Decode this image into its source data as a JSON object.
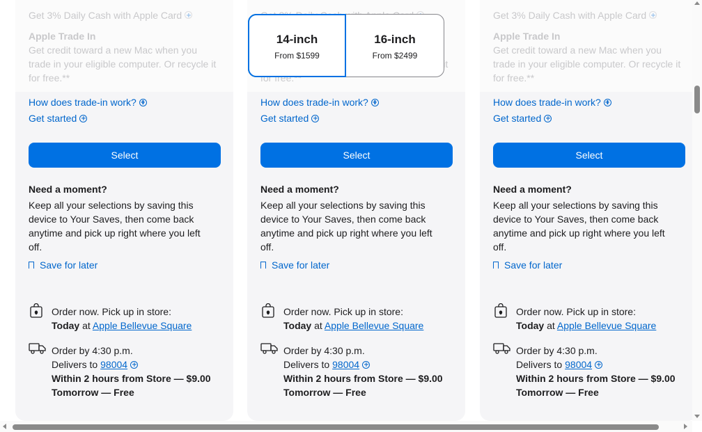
{
  "size_toggle": {
    "options": [
      {
        "size": "14-inch",
        "price": "From $1599",
        "selected": true
      },
      {
        "size": "16-inch",
        "price": "From $2499",
        "selected": false
      }
    ]
  },
  "faded": {
    "cash": "Get 3% Daily Cash with Apple Card",
    "trade_title": "Apple Trade In",
    "trade_body": "Get credit toward a new Mac when you trade in your eligible computer. Or recycle it for free.**"
  },
  "cards": [
    {
      "trade_link": "How does trade-in work?",
      "get_started": "Get started",
      "select_label": "Select",
      "moment_title": "Need a moment?",
      "moment_body": "Keep all your selections by saving this device to Your Saves, then come back anytime and pick up right where you left off.",
      "save_label": "Save for later",
      "pickup_label": "Order now. Pick up in store:",
      "pickup_day": "Today",
      "pickup_at": "at",
      "store": "Apple Bellevue Square",
      "order_by": "Order by 4:30 p.m.",
      "delivers_to": "Delivers to",
      "zip": "98004",
      "delivery_fast": "Within 2 hours from Store — $9.00",
      "delivery_free": "Tomorrow — Free"
    },
    {
      "trade_link": "How does trade-in work?",
      "get_started": "Get started",
      "select_label": "Select",
      "moment_title": "Need a moment?",
      "moment_body": "Keep all your selections by saving this device to Your Saves, then come back anytime and pick up right where you left off.",
      "save_label": "Save for later",
      "pickup_label": "Order now. Pick up in store:",
      "pickup_day": "Today",
      "pickup_at": "at",
      "store": "Apple Bellevue Square",
      "order_by": "Order by 4:30 p.m.",
      "delivers_to": "Delivers to",
      "zip": "98004",
      "delivery_fast": "Within 2 hours from Store — $9.00",
      "delivery_free": "Tomorrow — Free"
    },
    {
      "trade_link": "How does trade-in work?",
      "get_started": "Get started",
      "select_label": "Select",
      "moment_title": "Need a moment?",
      "moment_body": "Keep all your selections by saving this device to Your Saves, then come back anytime and pick up right where you left off.",
      "save_label": "Save for later",
      "pickup_label": "Order now. Pick up in store:",
      "pickup_day": "Today",
      "pickup_at": "at",
      "store": "Apple Bellevue Square",
      "order_by": "Order by 4:30 p.m.",
      "delivers_to": "Delivers to",
      "zip": "98004",
      "delivery_fast": "Within 2 hours from Store — $9.00",
      "delivery_free": "Tomorrow — Free"
    }
  ],
  "colors": {
    "accent": "#0071e3",
    "link": "#0066cc",
    "card_bg": "#f5f5f7"
  }
}
